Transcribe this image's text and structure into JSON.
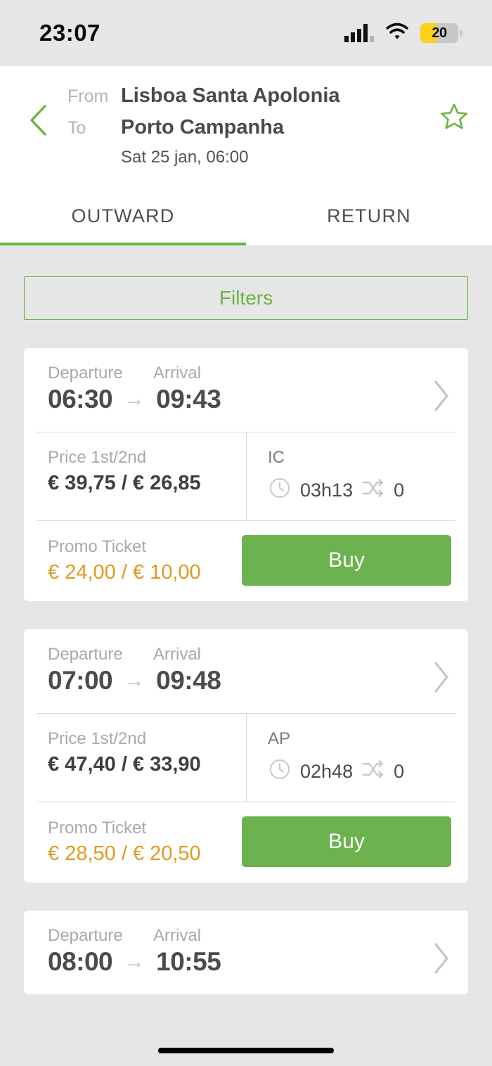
{
  "status_bar": {
    "time": "23:07",
    "battery_level": "20",
    "signal_icon": "signal-bars-icon",
    "wifi_icon": "wifi-icon",
    "battery_icon": "battery-icon"
  },
  "header": {
    "back_icon": "chevron-left-icon",
    "favorite_icon": "star-outline-icon",
    "from_label": "From",
    "from_value": "Lisboa Santa Apolonia",
    "to_label": "To",
    "to_value": "Porto Campanha",
    "date": "Sat 25 jan, 06:00",
    "tabs": [
      {
        "label": "OUTWARD",
        "active": true
      },
      {
        "label": "RETURN",
        "active": false
      }
    ]
  },
  "filters": {
    "label": "Filters"
  },
  "labels": {
    "departure": "Departure",
    "arrival": "Arrival",
    "price": "Price 1st/2nd",
    "promo": "Promo Ticket",
    "buy": "Buy",
    "arrow": "→",
    "chevron_icon": "chevron-right-icon",
    "clock_icon": "clock-icon",
    "transfers_icon": "transfers-shuffle-icon"
  },
  "colors": {
    "accent_green": "#6cb33f",
    "buy_green": "#6cb350",
    "promo_orange": "#e09a1e",
    "page_bg": "#e6e6e6",
    "card_bg": "#ffffff",
    "battery_yellow": "#fcd117"
  },
  "journeys": [
    {
      "departure": "06:30",
      "arrival": "09:43",
      "price": "€ 39,75 / € 26,85",
      "train_type": "IC",
      "duration": "03h13",
      "transfers": "0",
      "promo_price": "€ 24,00 / € 10,00",
      "buy_label": "Buy"
    },
    {
      "departure": "07:00",
      "arrival": "09:48",
      "price": "€ 47,40 / € 33,90",
      "train_type": "AP",
      "duration": "02h48",
      "transfers": "0",
      "promo_price": "€ 28,50 / € 20,50",
      "buy_label": "Buy"
    },
    {
      "departure": "08:00",
      "arrival": "10:55"
    }
  ]
}
